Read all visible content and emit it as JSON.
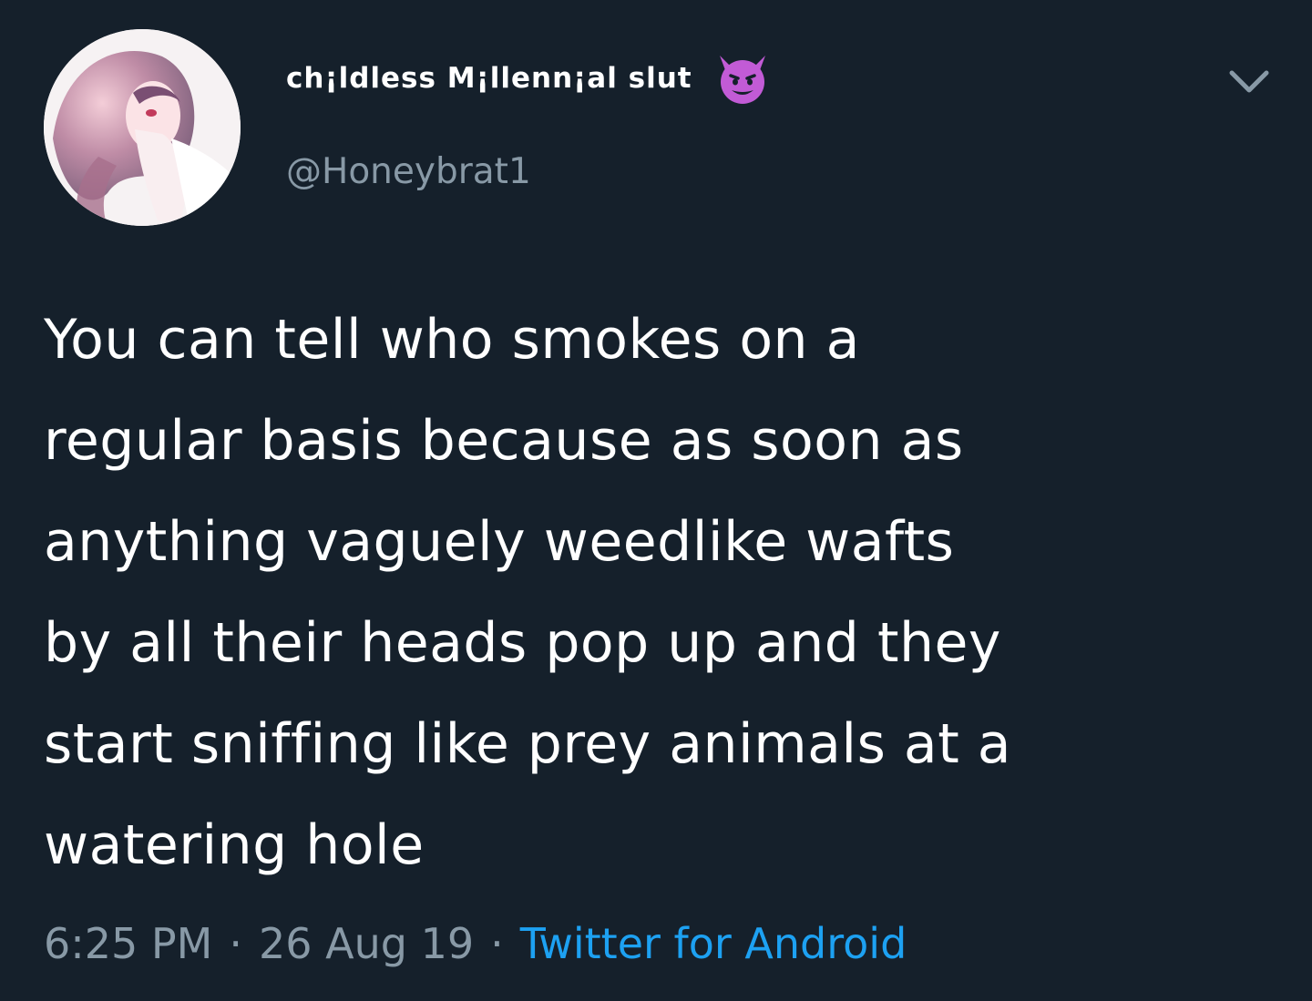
{
  "user": {
    "display_name": "ch¡ldless M¡llenn¡al slut",
    "badge_icon": "smiling-devil-emoji",
    "handle": "@Honeybrat1",
    "avatar_icon": "anime-girl-avatar"
  },
  "tweet": {
    "text": "You can tell who smokes on a\nregular basis because as soon as\nanything vaguely weedlike wafts\nby all their heads pop up and they\nstart sniffing like prey animals at a\nwatering hole"
  },
  "meta": {
    "time": "6:25 PM",
    "separator": "·",
    "date": "26 Aug 19",
    "source": "Twitter for Android"
  },
  "colors": {
    "background": "#15202b",
    "text": "#ffffff",
    "secondary_text": "#8899a6",
    "link": "#1da1f2",
    "emoji": "#c25bd6"
  }
}
